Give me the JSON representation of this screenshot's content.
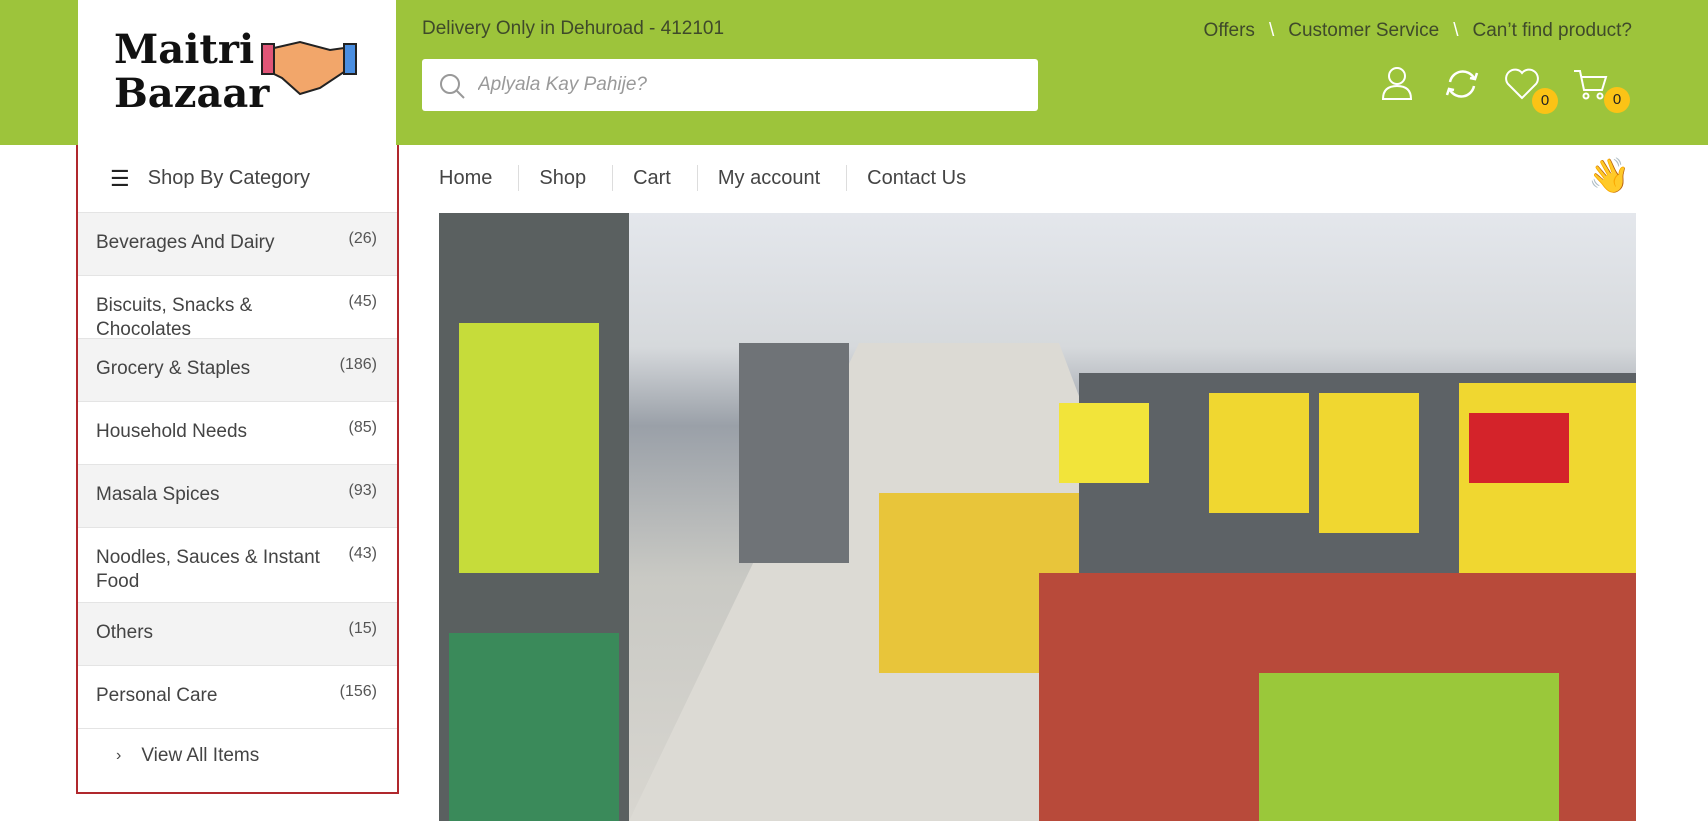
{
  "logo": {
    "line1": "Maitri",
    "line2": "Bazaar"
  },
  "header": {
    "delivery": "Delivery Only in Dehuroad - 412101",
    "search_placeholder": "Aplyala Kay Pahije?",
    "links": [
      "Offers",
      "Customer Service",
      "Can’t find product?"
    ],
    "separator": "\\",
    "wishlist_count": "0",
    "cart_count": "0"
  },
  "sidebar": {
    "title": "Shop By Category",
    "view_all": "View All Items",
    "categories": [
      {
        "label": "Beverages And Dairy",
        "count": "(26)"
      },
      {
        "label": "Biscuits, Snacks & Chocolates",
        "count": "(45)"
      },
      {
        "label": "Grocery & Staples",
        "count": "(186)"
      },
      {
        "label": "Household Needs",
        "count": "(85)"
      },
      {
        "label": "Masala Spices",
        "count": "(93)"
      },
      {
        "label": "Noodles, Sauces & Instant Food",
        "count": "(43)"
      },
      {
        "label": "Others",
        "count": "(15)"
      },
      {
        "label": "Personal Care",
        "count": "(156)"
      }
    ]
  },
  "nav": [
    "Home",
    "Shop",
    "Cart",
    "My account",
    "Contact Us"
  ],
  "colors": {
    "brand": "#9dc43b",
    "badge": "#fbc316",
    "sidebar_border": "#b0282d"
  }
}
